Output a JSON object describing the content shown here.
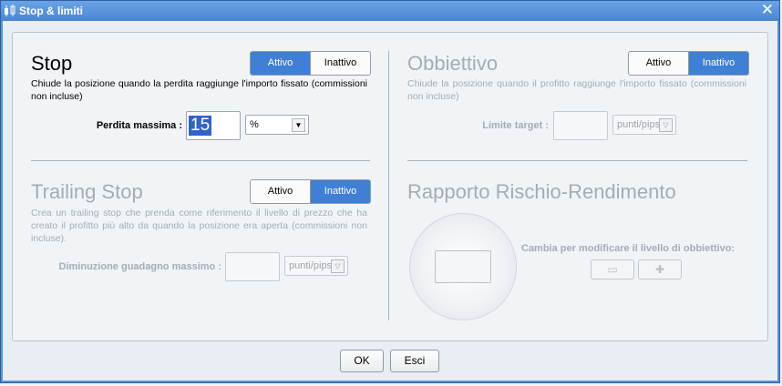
{
  "window": {
    "title": "Stop & limiti",
    "close_icon": "close-icon"
  },
  "stop": {
    "title": "Stop",
    "toggle": {
      "on_label": "Attivo",
      "off_label": "Inattivo",
      "selected": "Attivo"
    },
    "description": "Chiude la posizione quando la perdita raggiunge l'importo fissato (commissioni non incluse)",
    "field_label": "Perdita massima :",
    "field_value": "15",
    "unit": "%"
  },
  "obiettivo": {
    "title": "Obbiettivo",
    "toggle": {
      "on_label": "Attivo",
      "off_label": "Inattivo",
      "selected": "Inattivo"
    },
    "description": "Chiude la posizione quando il profitto raggiunge l'importo fissato (commissioni non incluse)",
    "field_label": "Limite target :",
    "unit": "punti/pips"
  },
  "trailing": {
    "title": "Trailing Stop",
    "toggle": {
      "on_label": "Attivo",
      "off_label": "Inattivo",
      "selected": "Inattivo"
    },
    "description": "Crea un trailing stop che prenda come riferimento il livello di prezzo che ha creato il profitto più alto da quando la posizione era aperta (commissioni non incluse).",
    "field_label": "Diminuzione guadagno massimo :",
    "unit": "punti/pips"
  },
  "rapporto": {
    "title": "Rapporto Rischio-Rendimento",
    "hint": "Cambia per modificare il livello di obbiettivo:",
    "minus_symbol": "▭",
    "plus_symbol": "✚"
  },
  "footer": {
    "ok_label": "OK",
    "cancel_label": "Esci"
  },
  "colors": {
    "accent": "#3f7fd6",
    "titlebar": "#5a93d6",
    "disabled_text": "#a4acb6"
  }
}
